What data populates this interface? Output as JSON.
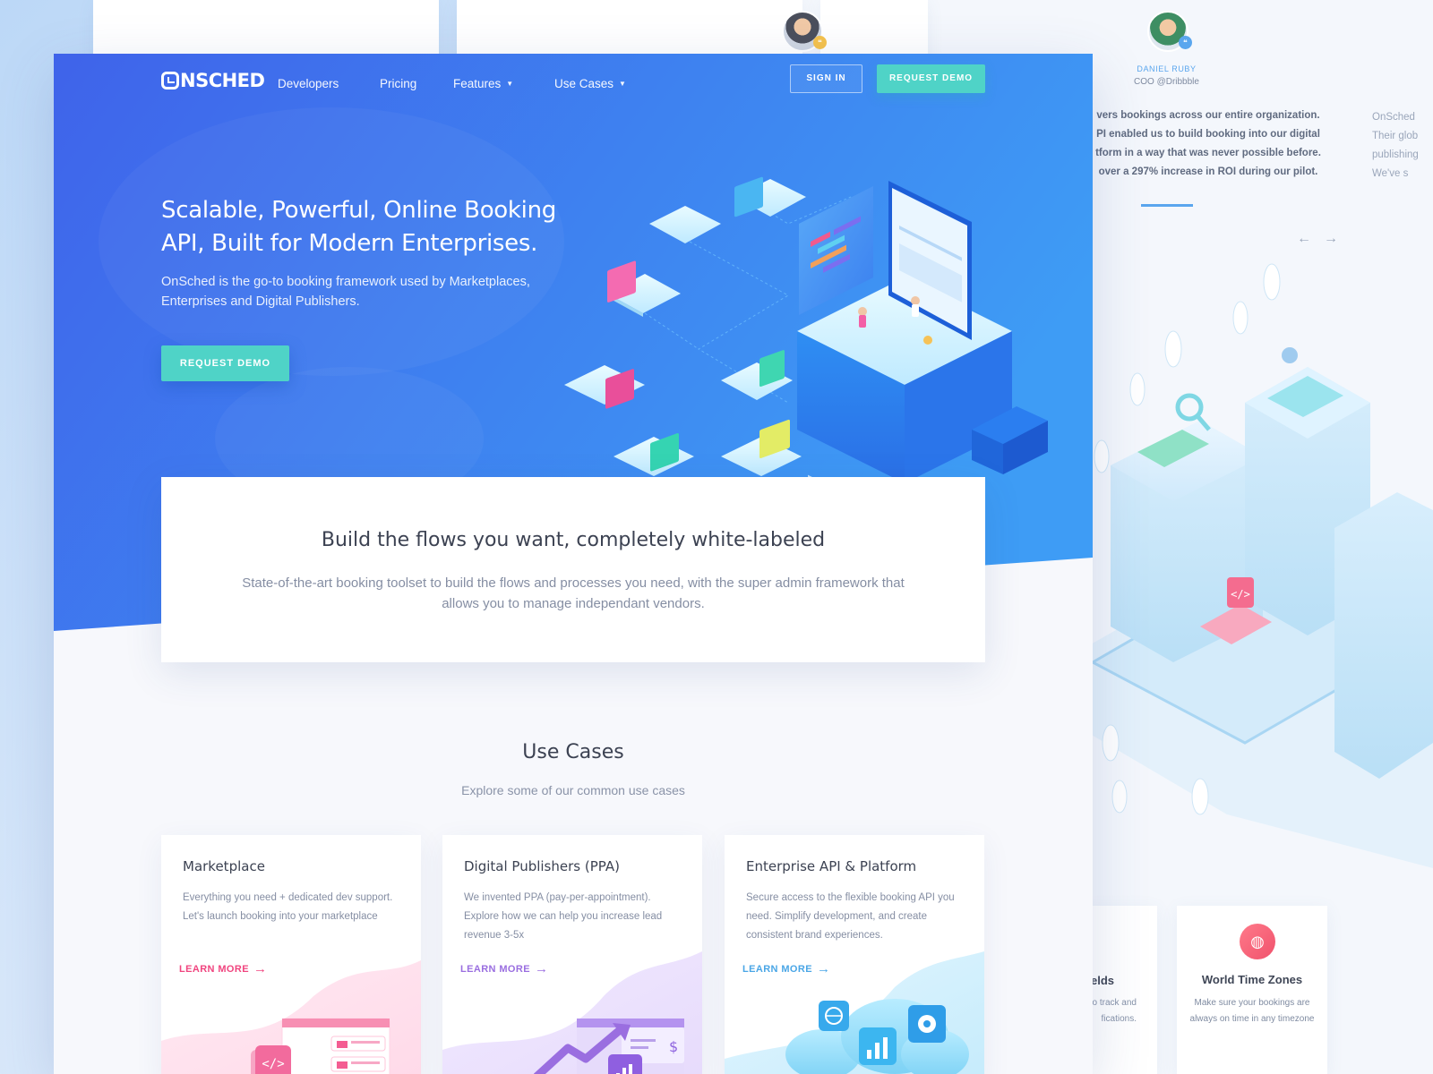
{
  "testimonials": {
    "person_name": "DANIEL RUBY",
    "person_role": "COO @Dribbble",
    "quote_lines": [
      "vers bookings across our entire organization.",
      "PI enabled us to build booking into our digital",
      "tform in a way that was never possible before.",
      "over a 297% increase in ROI during our pilot."
    ],
    "quote_2_lines": [
      "OnSched",
      "Their glob",
      "publishing",
      "We've s"
    ],
    "prev_arrow": "←",
    "next_arrow": "→"
  },
  "back_features": {
    "fields_title": "elds",
    "fields_desc_lines": [
      "o track and",
      "fications."
    ],
    "timezones_title": "World Time Zones",
    "timezones_desc": "Make sure your bookings are always on time in any timezone",
    "timezones_icon": "globe-icon"
  },
  "nav": {
    "logo_text": "NSCHED",
    "developers": "Developers",
    "pricing": "Pricing",
    "features": "Features",
    "use_cases": "Use Cases",
    "sign_in": "SIGN IN",
    "request_demo": "REQUEST DEMO"
  },
  "hero": {
    "title": "Scalable, Powerful, Online Booking API, Built for Modern Enterprises.",
    "subtitle": "OnSched is the go-to booking framework used by Marketplaces, Enterprises and Digital Publishers.",
    "cta": "REQUEST DEMO"
  },
  "build": {
    "title": "Build the flows you want, completely white-labeled",
    "description": "State-of-the-art booking toolset to build the flows and processes you need, with the super admin framework that allows you to manage independant vendors."
  },
  "use_cases": {
    "title": "Use Cases",
    "subtitle": "Explore some of our common use cases",
    "cards": [
      {
        "title": "Marketplace",
        "description": "Everything you need + dedicated dev support. Let's launch booking into your marketplace",
        "link": "LEARN MORE",
        "accent": "#f0457f"
      },
      {
        "title": "Digital Publishers (PPA)",
        "description": "We invented PPA (pay-per-appointment). Explore how we can help you increase lead revenue 3-5x",
        "link": "LEARN MORE",
        "accent": "#9a6ee0"
      },
      {
        "title": "Enterprise API & Platform",
        "description": "Secure access to the flexible booking API you need. Simplify development, and create consistent brand experiences.",
        "link": "LEARN MORE",
        "accent": "#4aa6e6"
      }
    ]
  },
  "colors": {
    "hero_gradient_start": "#3f63ea",
    "hero_gradient_end": "#3e9cf5",
    "teal": "#4fd3c7",
    "heading": "#3c4252"
  }
}
